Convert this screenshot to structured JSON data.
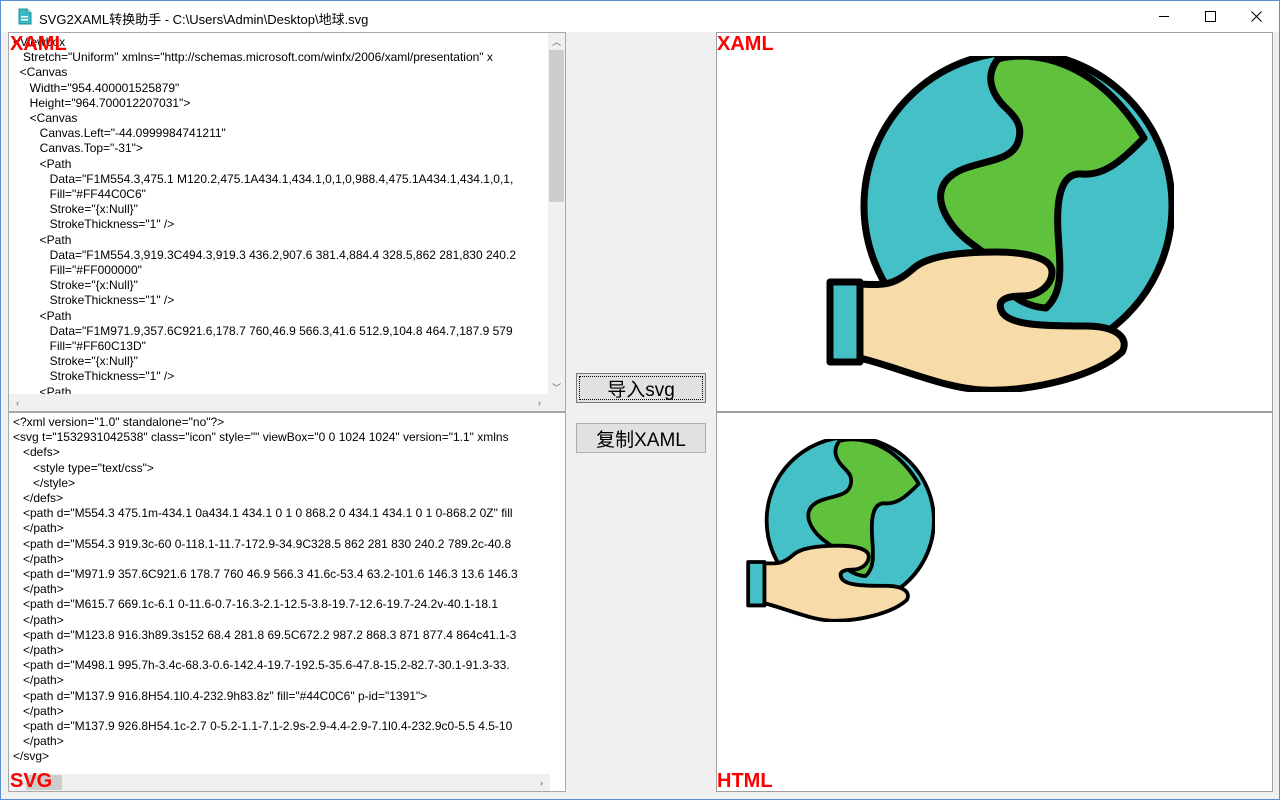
{
  "window": {
    "title": "SVG2XAML转换助手 - C:\\Users\\Admin\\Desktop\\地球.svg",
    "controls": [
      "minimize",
      "maximize",
      "close"
    ]
  },
  "xaml_editor": {
    "label": "XAML",
    "code": "<Viewbox\n   Stretch=\"Uniform\" xmlns=\"http://schemas.microsoft.com/winfx/2006/xaml/presentation\" x\n  <Canvas\n     Width=\"954.400001525879\"\n     Height=\"964.700012207031\">\n     <Canvas\n        Canvas.Left=\"-44.0999984741211\"\n        Canvas.Top=\"-31\">\n        <Path\n           Data=\"F1M554.3,475.1 M120.2,475.1A434.1,434.1,0,1,0,988.4,475.1A434.1,434.1,0,1,\n           Fill=\"#FF44C0C6\"\n           Stroke=\"{x:Null}\"\n           StrokeThickness=\"1\" />\n        <Path\n           Data=\"F1M554.3,919.3C494.3,919.3 436.2,907.6 381.4,884.4 328.5,862 281,830 240.2\n           Fill=\"#FF000000\"\n           Stroke=\"{x:Null}\"\n           StrokeThickness=\"1\" />\n        <Path\n           Data=\"F1M971.9,357.6C921.6,178.7 760,46.9 566.3,41.6 512.9,104.8 464.7,187.9 579\n           Fill=\"#FF60C13D\"\n           Stroke=\"{x:Null}\"\n           StrokeThickness=\"1\" />\n        <Path"
  },
  "svg_editor": {
    "label": "SVG",
    "code": "<?xml version=\"1.0\" standalone=\"no\"?>\n<svg t=\"1532931042538\" class=\"icon\" style=\"\" viewBox=\"0 0 1024 1024\" version=\"1.1\" xmlns\n   <defs>\n      <style type=\"text/css\">\n      </style>\n   </defs>\n   <path d=\"M554.3 475.1m-434.1 0a434.1 434.1 0 1 0 868.2 0 434.1 434.1 0 1 0-868.2 0Z\" fill\n   </path>\n   <path d=\"M554.3 919.3c-60 0-118.1-11.7-172.9-34.9C328.5 862 281 830 240.2 789.2c-40.8\n   </path>\n   <path d=\"M971.9 357.6C921.6 178.7 760 46.9 566.3 41.6c-53.4 63.2-101.6 146.3 13.6 146.3\n   </path>\n   <path d=\"M615.7 669.1c-6.1 0-11.6-0.7-16.3-2.1-12.5-3.8-19.7-12.6-19.7-24.2v-40.1-18.1\n   </path>\n   <path d=\"M123.8 916.3h89.3s152 68.4 281.8 69.5C672.2 987.2 868.3 871 877.4 864c41.1-3\n   </path>\n   <path d=\"M498.1 995.7h-3.4c-68.3-0.6-142.4-19.7-192.5-35.6-47.8-15.2-82.7-30.1-91.3-33.\n   </path>\n   <path d=\"M137.9 916.8H54.1l0.4-232.9h83.8z\" fill=\"#44C0C6\" p-id=\"1391\">\n   </path>\n   <path d=\"M137.9 926.8H54.1c-2.7 0-5.2-1.1-7.1-2.9s-2.9-4.4-2.9-7.1l0.4-232.9c0-5.5 4.5-10\n   </path>\n</svg>"
  },
  "buttons": {
    "import_svg": "导入svg",
    "copy_xaml": "复制XAML"
  },
  "preview_xaml": {
    "label": "XAML"
  },
  "preview_html": {
    "label": "HTML"
  },
  "colors": {
    "globe_ocean": "#44C0C6",
    "globe_land": "#60C13D",
    "hand": "#F7DBA9",
    "outline": "#000000",
    "label_red": "#FF0000"
  }
}
